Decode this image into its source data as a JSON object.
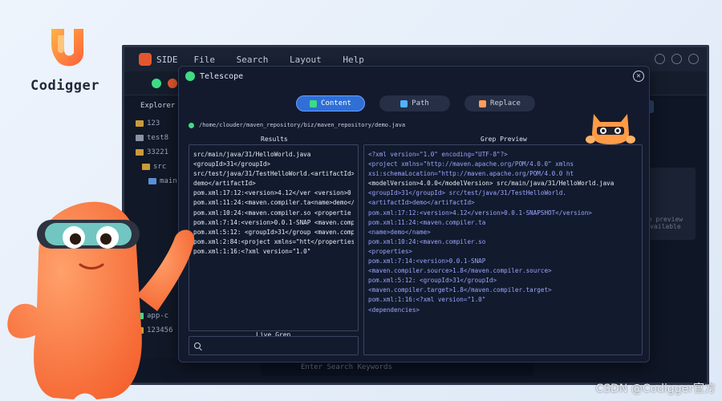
{
  "brand": {
    "name": "Codigger"
  },
  "ide": {
    "title": "SIDE",
    "menu": [
      "File",
      "Search",
      "Layout",
      "Help"
    ],
    "sidebar": {
      "title": "Explorer",
      "items": [
        "123",
        "test8",
        "33221",
        "src",
        "main",
        "app-c",
        "123456"
      ]
    },
    "status_placeholder": "Enter Search Keywords",
    "right_panel_text": "No preview available"
  },
  "telescope": {
    "title": "Telescope",
    "tabs": [
      {
        "label": "Content",
        "active": true
      },
      {
        "label": "Path",
        "active": false
      },
      {
        "label": "Replace",
        "active": false
      }
    ],
    "path": "/home/clouder/maven_repository/biz/maven_repository/demo.java",
    "results_label": "Results",
    "preview_label": "Grep Preview",
    "live_grep_label": "Live Grep",
    "results": [
      "src/main/java/31/HelloWorld.java",
      "<groupId>31</groupId>",
      "src/test/java/31/TestHelloWorld.<artifactId>",
      "demo</artifactId>",
      "pom.xml:17:12:<version>4.12</ver <version>0",
      "pom.xml:11:24:<maven.compiler.ta<name>demo</",
      "pom.xml:10:24:<maven.compiler.so <propertie",
      "pom.xml:7:14:<version>0.0.1-SNAP <maven.comp",
      "pom.xml:5:12: <groupId>31</group <maven.comp",
      "pom.xml:2:84:<project xmlns=\"htt</properties",
      "pom.xml:1:16:<?xml version=\"1.0\""
    ],
    "preview": [
      "<?xml version=\"1.0\" encoding=\"UTF-8\"?>",
      "<project xmlns=\"http://maven.apache.org/POM/4.0.0\" xmlns",
      "xsi:schemaLocation=\"http://maven.apache.org/POM/4.0.0 ht",
      "<modelVersion>4.0.0</modelVersion> src/main/java/31/HelloWorld.java",
      "<groupId>31</groupId> src/test/java/31/TestHelloWorld.",
      "<artifactId>demo</artifactId>",
      "pom.xml:17:12:<version>4.12</version>0.0.1-SNAPSHOT</version>",
      "pom.xml:11:24:<maven.compiler.ta",
      "<name>demo</name>",
      "pom.xml:10:24:<maven.compiler.so",
      "<properties>",
      "pom.xml:7:14:<version>0.0.1-SNAP",
      "<maven.compiler.source>1.8</maven.compiler.source>",
      "pom.xml:5:12: <groupId>31</groupId>",
      "<maven.compiler.target>1.8</maven.compiler.target>",
      "pom.xml:1:16:<?xml version=\"1.0\"",
      "<dependencies>"
    ]
  },
  "watermark": "CSDN @Codigger官方",
  "colors": {
    "accent": "#2f6fd6",
    "dialog_bg": "#131a2e",
    "mascot": "#ff7a45",
    "brand_orange": "#ff8a3d"
  }
}
